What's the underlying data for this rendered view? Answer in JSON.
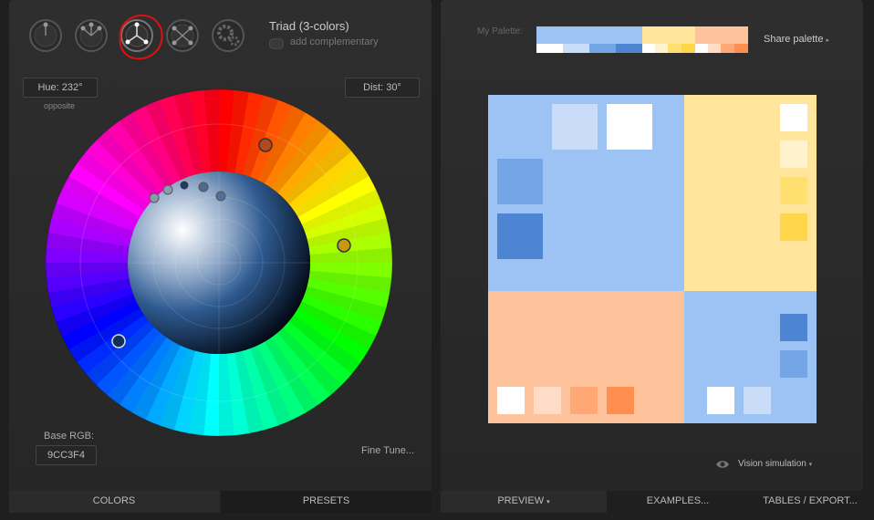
{
  "scheme": {
    "modes": [
      {
        "name": "mono",
        "icon": "mono-scheme-icon"
      },
      {
        "name": "adjacent",
        "icon": "adjacent-scheme-icon"
      },
      {
        "name": "triad",
        "icon": "triad-scheme-icon",
        "selected": true
      },
      {
        "name": "tetrad",
        "icon": "tetrad-scheme-icon"
      },
      {
        "name": "free",
        "icon": "free-scheme-icon"
      }
    ],
    "title": "Triad (3-colors)",
    "add_complementary": "add complementary"
  },
  "hue": {
    "label": "Hue: 232°",
    "sub": "opposite"
  },
  "dist": {
    "label": "Dist: 30°"
  },
  "base": {
    "label": "Base RGB:",
    "value": "9CC3F4"
  },
  "fine_tune": "Fine Tune...",
  "left_tabs": {
    "colors": "COLORS",
    "presets": "PRESETS"
  },
  "palette": {
    "label": "My Palette:",
    "share": "Share palette",
    "colors": {
      "blue": "#9cc3f4",
      "yellow": "#ffe69c",
      "peach": "#ffc39c"
    }
  },
  "vision": "Vision simulation",
  "right_tabs": {
    "preview": "PREVIEW",
    "examples": "EXAMPLES...",
    "tables": "TABLES / EXPORT..."
  }
}
